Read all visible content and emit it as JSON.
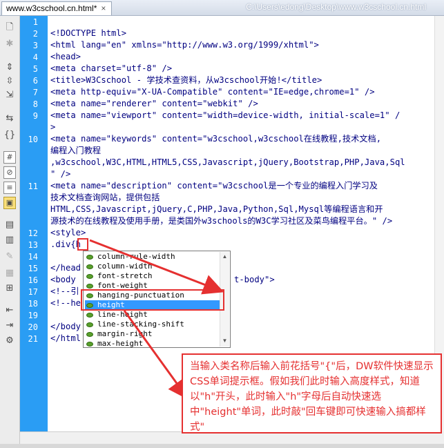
{
  "window": {
    "tab_label": "www.w3cschool.cn.html*",
    "tab_close": "×",
    "file_path": "C:\\Users\\edong\\Desktop\\www.w3cschool.cn.html"
  },
  "toolbar_icons": [
    "document-icon",
    "gear-icon",
    "expand-icon",
    "collapse-icon",
    "select-tag-icon",
    "indent-icon",
    "outdent-icon",
    "braces-icon",
    "comment-icon",
    "remove-comment-icon",
    "wrap-tag-icon",
    "recent-snippets-icon",
    "move-css-icon",
    "format-icon",
    "indent-code-icon",
    "outdent-code-icon",
    "format-source-icon"
  ],
  "line_numbers": [
    "1",
    "2",
    "3",
    "4",
    "5",
    "6",
    "7",
    "8",
    "9",
    "10",
    "11",
    "12",
    "13",
    "14",
    "15",
    "16",
    "17",
    "18",
    "19",
    "20",
    "21"
  ],
  "code_lines": [
    "<!DOCTYPE html>",
    "<html lang=\"en\" xmlns=\"http://www.w3.org/1999/xhtml\">",
    "<head>",
    "<meta charset=\"utf-8\" />",
    "<title>W3Cschool - 学技术查资料，从w3cschool开始!</title>",
    "<meta http-equiv=\"X-UA-Compatible\" content=\"IE=edge,chrome=1\" />",
    "<meta name=\"renderer\" content=\"webkit\" />",
    "<meta name=\"viewport\" content=\"width=device-width, initial-scale=1\" /",
    ">",
    "<meta name=\"keywords\" content=\"w3cschool,w3cschool在线教程,技术文档,",
    "编程入门教程",
    ",w3cschool,W3C,HTML,HTML5,CSS,Javascript,jQuery,Bootstrap,PHP,Java,Sql",
    "\" />",
    "<meta name=\"description\" content=\"w3cschool是一个专业的编程入门学习及",
    "技术文档查询网站，提供包括",
    "HTML,CSS,Javascript,jQuery,C,PHP,Java,Python,Sql,Mysql等编程语言和开",
    "源技术的在线教程及使用手册，是类国外w3schools的W3C学习社区及菜鸟编程平台。\" />",
    "<style>",
    ".div{h",
    "",
    "</head",
    "<body",
    "t-body\">",
    "<!--引",
    "<!--he",
    "</body",
    "</html"
  ],
  "autocomplete": {
    "items": [
      "column-rule-width",
      "column-width",
      "font-stretch",
      "font-weight",
      "hanging-punctuation",
      "height",
      "line-height",
      "line-stacking-shift",
      "margin-right",
      "max-height"
    ],
    "selected": "height",
    "scroll_up": "▲",
    "scroll_down": "▼"
  },
  "annotation": {
    "text": "当输入类名称后输入前花括号\"{\"后，DW软件快速显示CSS单词提示框。假如我们此时输入高度样式，知道以\"h\"开头，此时输入\"h\"字母后自动快速选中\"height\"单词，此时敲\"回车键即可快速输入搞都样式\""
  },
  "colors": {
    "gutter": "#2a9df4",
    "code_text": "#000080",
    "selection": "#3399ff",
    "annotation_red": "#e53030"
  }
}
